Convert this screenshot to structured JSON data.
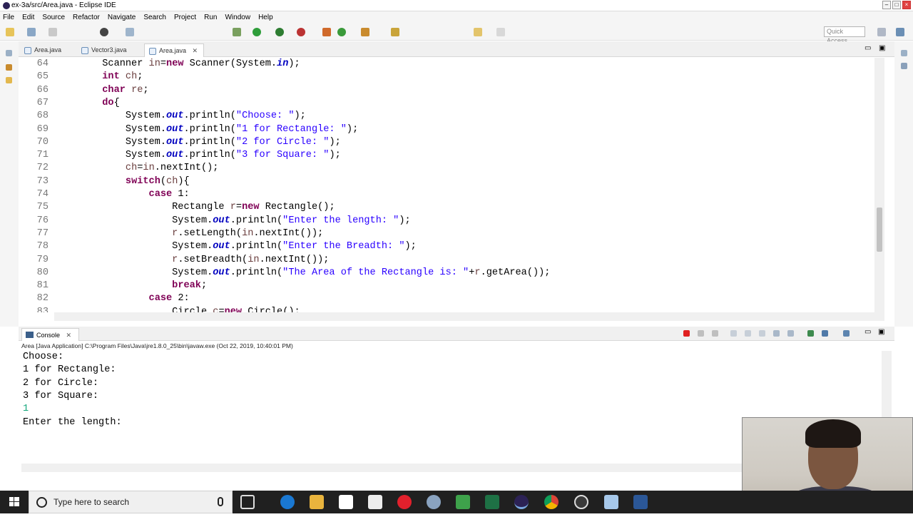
{
  "window": {
    "title": "ex-3a/src/Area.java - Eclipse IDE"
  },
  "menu": [
    "File",
    "Edit",
    "Source",
    "Refactor",
    "Navigate",
    "Search",
    "Project",
    "Run",
    "Window",
    "Help"
  ],
  "toolbar": {
    "quick_access_placeholder": "Quick Access"
  },
  "editor_tabs": [
    {
      "label": "Area.java",
      "active": false
    },
    {
      "label": "Vector3.java",
      "active": false
    },
    {
      "label": "Area.java",
      "active": true
    }
  ],
  "editor": {
    "lines": [
      {
        "num": "64",
        "html": "        Scanner <span class=\"var\">in</span>=<span class=\"kw\">new</span> Scanner(System.<span class=\"fld\">in</span>);"
      },
      {
        "num": "65",
        "html": "        <span class=\"kw\">int</span> <span class=\"var\">ch</span>;"
      },
      {
        "num": "66",
        "html": "        <span class=\"kw\">char</span> <span class=\"var\">re</span>;"
      },
      {
        "num": "67",
        "html": "        <span class=\"kw\">do</span>{"
      },
      {
        "num": "68",
        "html": "            System.<span class=\"fld\">out</span>.println(<span class=\"str\">\"Choose: \"</span>);"
      },
      {
        "num": "69",
        "html": "            System.<span class=\"fld\">out</span>.println(<span class=\"str\">\"1 for Rectangle: \"</span>);"
      },
      {
        "num": "70",
        "html": "            System.<span class=\"fld\">out</span>.println(<span class=\"str\">\"2 for Circle: \"</span>);"
      },
      {
        "num": "71",
        "html": "            System.<span class=\"fld\">out</span>.println(<span class=\"str\">\"3 for Square: \"</span>);"
      },
      {
        "num": "72",
        "html": "            <span class=\"var\">ch</span>=<span class=\"var\">in</span>.nextInt();"
      },
      {
        "num": "73",
        "html": "            <span class=\"kw\">switch</span>(<span class=\"var\">ch</span>){"
      },
      {
        "num": "74",
        "html": "                <span class=\"kw\">case</span> 1:"
      },
      {
        "num": "75",
        "html": "                    Rectangle <span class=\"var\">r</span>=<span class=\"kw\">new</span> Rectangle();"
      },
      {
        "num": "76",
        "html": "                    System.<span class=\"fld\">out</span>.println(<span class=\"str\">\"Enter the length: \"</span>);"
      },
      {
        "num": "77",
        "html": "                    <span class=\"var\">r</span>.setLength(<span class=\"var\">in</span>.nextInt());"
      },
      {
        "num": "78",
        "html": "                    System.<span class=\"fld\">out</span>.println(<span class=\"str\">\"Enter the Breadth: \"</span>);"
      },
      {
        "num": "79",
        "html": "                    <span class=\"var\">r</span>.setBreadth(<span class=\"var\">in</span>.nextInt());"
      },
      {
        "num": "80",
        "html": "                    System.<span class=\"fld\">out</span>.println(<span class=\"str\">\"The Area of the Rectangle is: \"</span>+<span class=\"var\">r</span>.getArea());"
      },
      {
        "num": "81",
        "html": "                    <span class=\"kw\">break</span>;"
      },
      {
        "num": "82",
        "html": "                <span class=\"kw\">case</span> 2:"
      },
      {
        "num": "83",
        "html": "                    Circle <span class=\"var\">c</span>=<span class=\"kw\">new</span> Circle();"
      }
    ]
  },
  "console": {
    "tab_label": "Console",
    "launch_info": "Area [Java Application] C:\\Program Files\\Java\\jre1.8.0_25\\bin\\javaw.exe (Oct 22, 2019, 10:40:01 PM)",
    "lines": [
      {
        "text": "Choose:",
        "input": false
      },
      {
        "text": "1 for Rectangle:",
        "input": false
      },
      {
        "text": "2 for Circle:",
        "input": false
      },
      {
        "text": "3 for Square:",
        "input": false
      },
      {
        "text": "1",
        "input": true
      },
      {
        "text": "Enter the length:",
        "input": false
      }
    ]
  },
  "taskbar": {
    "search_placeholder": "Type here to search"
  }
}
